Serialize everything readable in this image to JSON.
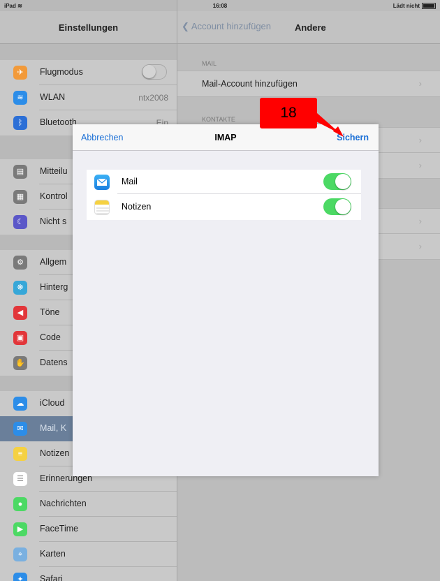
{
  "statusbar": {
    "device": "iPad",
    "time": "16:08",
    "battery_text": "Lädt nicht"
  },
  "sidebar": {
    "title": "Einstellungen",
    "items": [
      {
        "label": "Flugmodus",
        "value": "",
        "icon": "airplane-icon",
        "color": "#f29a3a"
      },
      {
        "label": "WLAN",
        "value": "ntx2008",
        "icon": "wifi-icon",
        "color": "#2c8de8"
      },
      {
        "label": "Bluetooth",
        "value": "Ein",
        "icon": "bluetooth-icon",
        "color": "#2c6fd6"
      },
      {
        "label": "Mitteilu",
        "value": "",
        "icon": "notifications-icon",
        "color": "#7a7a7a"
      },
      {
        "label": "Kontrol",
        "value": "",
        "icon": "control-center-icon",
        "color": "#7a7a7a"
      },
      {
        "label": "Nicht s",
        "value": "",
        "icon": "moon-icon",
        "color": "#5b57c8"
      },
      {
        "label": "Allgem",
        "value": "",
        "icon": "gear-icon",
        "color": "#7a7a7a"
      },
      {
        "label": "Hinterg",
        "value": "",
        "icon": "wallpaper-icon",
        "color": "#36a7d8"
      },
      {
        "label": "Töne",
        "value": "",
        "icon": "speaker-icon",
        "color": "#e2363a"
      },
      {
        "label": "Code",
        "value": "",
        "icon": "lock-icon",
        "color": "#e2363a"
      },
      {
        "label": "Datens",
        "value": "",
        "icon": "hand-icon",
        "color": "#7a7a7a"
      },
      {
        "label": "iCloud",
        "value": "",
        "icon": "cloud-icon",
        "color": "#2c8de8"
      },
      {
        "label": "Mail, K",
        "value": "",
        "icon": "envelope-icon",
        "color": "#2c8de8"
      },
      {
        "label": "Notizen",
        "value": "",
        "icon": "notes-icon",
        "color": "#f5d142"
      },
      {
        "label": "Erinnerungen",
        "value": "",
        "icon": "list-icon",
        "color": "#ffffff"
      },
      {
        "label": "Nachrichten",
        "value": "",
        "icon": "speech-bubble-icon",
        "color": "#4cd964"
      },
      {
        "label": "FaceTime",
        "value": "",
        "icon": "video-camera-icon",
        "color": "#4cd964"
      },
      {
        "label": "Karten",
        "value": "",
        "icon": "map-icon",
        "color": "#7ab0e0"
      },
      {
        "label": "Safari",
        "value": "",
        "icon": "compass-icon",
        "color": "#2c8de8"
      }
    ]
  },
  "rightpane": {
    "back_label": "Account hinzufügen",
    "title": "Andere",
    "section_mail": "MAIL",
    "mail_row": "Mail-Account hinzufügen",
    "section_contacts": "KONTAKTE"
  },
  "modal": {
    "cancel": "Abbrechen",
    "title": "IMAP",
    "save": "Sichern",
    "rows": [
      {
        "label": "Mail",
        "on": true
      },
      {
        "label": "Notizen",
        "on": true
      }
    ]
  },
  "annotation": {
    "number": "18",
    "color": "#ff0000"
  }
}
